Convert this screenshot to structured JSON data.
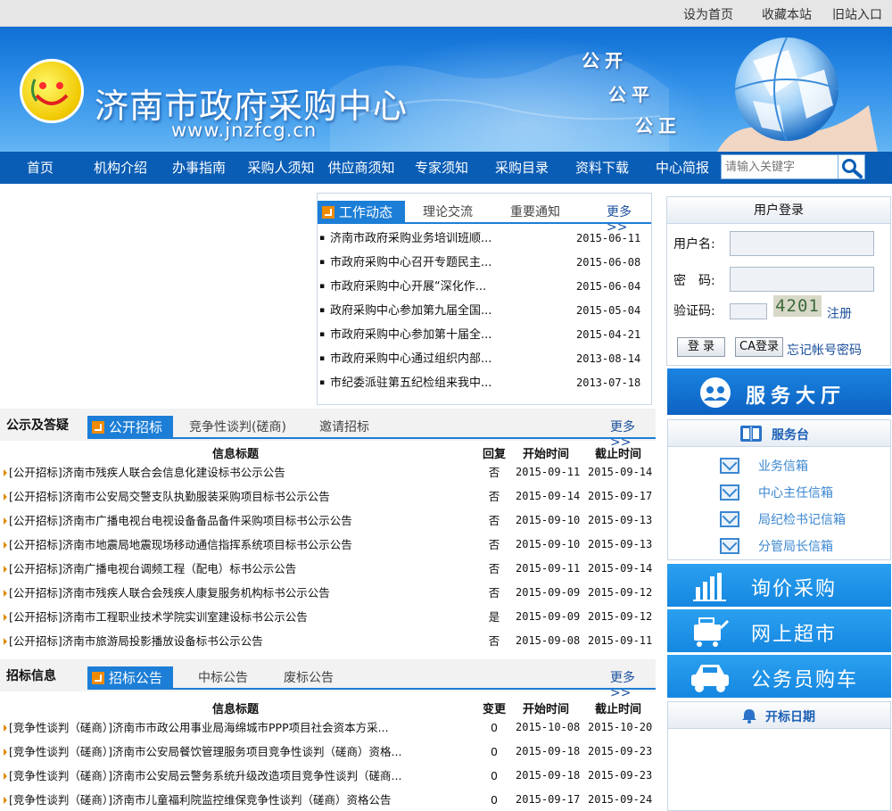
{
  "topbar": {
    "set_home": "设为首页",
    "bookmark": "收藏本站",
    "old_site": "旧站入口"
  },
  "banner": {
    "title": "济南市政府采购中心",
    "url": "www.jnzfcg.cn",
    "slogan": [
      "公开",
      "公平",
      "公正"
    ]
  },
  "nav": {
    "items": [
      "首页",
      "机构介绍",
      "办事指南",
      "采购人须知",
      "供应商须知",
      "专家须知",
      "采购目录",
      "资料下载",
      "中心简报"
    ],
    "search_placeholder": "请输入关键字"
  },
  "news": {
    "tabs": [
      "工作动态",
      "理论交流",
      "重要通知"
    ],
    "more": "更多>>",
    "items": [
      {
        "title": "济南市政府采购业务培训班顺...",
        "date": "2015-06-11"
      },
      {
        "title": "市政府采购中心召开专题民主...",
        "date": "2015-06-08"
      },
      {
        "title": "市政府采购中心开展“深化作...",
        "date": "2015-06-04"
      },
      {
        "title": "政府采购中心参加第九届全国...",
        "date": "2015-05-04"
      },
      {
        "title": "市政府采购中心参加第十届全...",
        "date": "2015-04-21"
      },
      {
        "title": "市政府采购中心通过组织内部...",
        "date": "2013-08-14"
      },
      {
        "title": "市纪委派驻第五纪检组来我中...",
        "date": "2013-07-18"
      }
    ]
  },
  "notice": {
    "section_title": "公示及答疑",
    "tabs": [
      "公开招标",
      "竞争性谈判(磋商)",
      "邀请招标"
    ],
    "more": "更多>>",
    "headers": [
      "信息标题",
      "回复",
      "开始时间",
      "截止时间"
    ],
    "rows": [
      {
        "title": "[公开招标]济南市残疾人联合会信息化建设标书公示公告",
        "reply": "否",
        "start": "2015-09-11",
        "end": "2015-09-14"
      },
      {
        "title": "[公开招标]济南市公安局交警支队执勤服装采购项目标书公示公告",
        "reply": "否",
        "start": "2015-09-14",
        "end": "2015-09-17"
      },
      {
        "title": "[公开招标]济南市广播电视台电视设备备品备件采购项目标书公示公告",
        "reply": "否",
        "start": "2015-09-10",
        "end": "2015-09-13"
      },
      {
        "title": "[公开招标]济南市地震局地震现场移动通信指挥系统项目标书公示公告",
        "reply": "否",
        "start": "2015-09-10",
        "end": "2015-09-13"
      },
      {
        "title": "[公开招标]济南广播电视台调频工程（配电）标书公示公告",
        "reply": "否",
        "start": "2015-09-11",
        "end": "2015-09-14"
      },
      {
        "title": "[公开招标]济南市残疾人联合会残疾人康复服务机构标书公示公告",
        "reply": "否",
        "start": "2015-09-09",
        "end": "2015-09-12"
      },
      {
        "title": "[公开招标]济南市工程职业技术学院实训室建设标书公示公告",
        "reply": "是",
        "start": "2015-09-09",
        "end": "2015-09-12"
      },
      {
        "title": "[公开招标]济南市旅游局投影播放设备标书公示公告",
        "reply": "否",
        "start": "2015-09-08",
        "end": "2015-09-11"
      }
    ]
  },
  "tender": {
    "section_title": "招标信息",
    "tabs": [
      "招标公告",
      "中标公告",
      "废标公告"
    ],
    "more": "更多>>",
    "headers": [
      "信息标题",
      "变更",
      "开始时间",
      "截止时间"
    ],
    "rows": [
      {
        "title": "[竞争性谈判（磋商）]济南市市政公用事业局海绵城市PPP项目社会资本方采...",
        "change": "0",
        "start": "2015-10-08",
        "end": "2015-10-20"
      },
      {
        "title": "[竞争性谈判（磋商）]济南市公安局餐饮管理服务项目竞争性谈判（磋商）资格...",
        "change": "0",
        "start": "2015-09-18",
        "end": "2015-09-23"
      },
      {
        "title": "[竞争性谈判（磋商）]济南市公安局云警务系统升级改造项目竞争性谈判（磋商...",
        "change": "0",
        "start": "2015-09-18",
        "end": "2015-09-23"
      },
      {
        "title": "[竞争性谈判（磋商）]济南市儿童福利院监控维保竞争性谈判（磋商）资格公告",
        "change": "0",
        "start": "2015-09-17",
        "end": "2015-09-24"
      }
    ]
  },
  "login": {
    "title": "用户登录",
    "username_label": "用户名:",
    "password_label": "密　码:",
    "captcha_label": "验证码:",
    "captcha_code": "4201",
    "register": "注册",
    "login_btn": "登 录",
    "ca_btn": "CA登录",
    "forgot": "忘记帐号密码"
  },
  "service_hall": {
    "label": "服务大厅"
  },
  "service_desk": {
    "title": "服务台",
    "items": [
      "业务信箱",
      "中心主任信箱",
      "局纪检书记信箱",
      "分管局长信箱"
    ]
  },
  "tiles": [
    {
      "label": "询价采购",
      "icon": "bar-chart-icon"
    },
    {
      "label": "网上超市",
      "icon": "shopping-cart-icon"
    },
    {
      "label": "公务员购车",
      "icon": "car-icon"
    }
  ],
  "bid_date": {
    "title": "开标日期"
  },
  "colors": {
    "nav": "#0a5db5",
    "tab": "#1c7ed6",
    "tile": "#1e93e8",
    "link": "#1a4f9c"
  }
}
